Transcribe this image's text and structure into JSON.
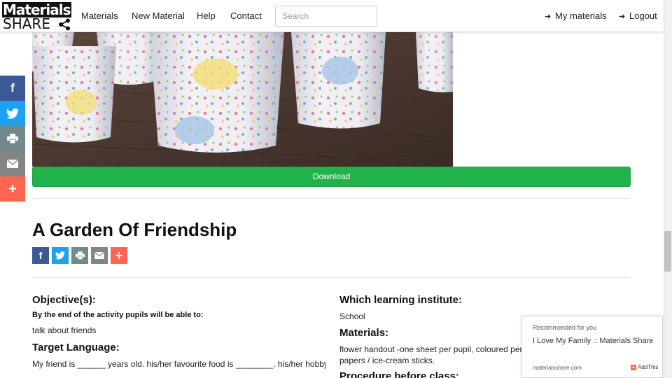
{
  "nav": {
    "logo_top": "Materials",
    "logo_bottom": "SHARE",
    "links": [
      "Materials",
      "New Material",
      "Help",
      "Contact"
    ],
    "search_placeholder": "Search",
    "my_materials": "My materials",
    "logout": "Logout"
  },
  "sidebar": {
    "buttons": [
      {
        "icon": "facebook-icon",
        "glyph": "f",
        "color": "#3b5998"
      },
      {
        "icon": "twitter-icon",
        "glyph": "t",
        "color": "#1da1f2"
      },
      {
        "icon": "print-icon",
        "glyph": "p",
        "color": "#738a8d"
      },
      {
        "icon": "email-icon",
        "glyph": "e",
        "color": "#848484"
      },
      {
        "icon": "more-icon",
        "glyph": "+",
        "color": "#ff6550"
      }
    ]
  },
  "main": {
    "download_label": "Download",
    "title": "A Garden Of Friendship"
  },
  "left_col": {
    "objective_heading": "Objective(s):",
    "objective_sub": "By the end of the activity pupils will be able to:",
    "objective_text": "talk about friends",
    "target_heading": "Target Language:",
    "target_text": "My friend is ______ years old. his/her favourite food is ________. his/her hobby is"
  },
  "right_col": {
    "institute_heading": "Which learning institute:",
    "institute_value": "School",
    "materials_heading": "Materials:",
    "materials_line1": "flower handout -one sheet per pupil, coloured pen",
    "materials_line2": "papers / ice-cream sticks.",
    "procedure_heading": "Procedure before class:"
  },
  "recommended": {
    "label": "Recommended for you",
    "item": "I Love My Family :: Materials Share",
    "domain": "materialsshare.com",
    "addthis": "AddThis"
  },
  "colors": {
    "download_green": "#22b24c",
    "facebook": "#3b5998",
    "twitter": "#1da1f2",
    "print": "#738a8d",
    "email": "#848484",
    "more": "#ff6550"
  }
}
